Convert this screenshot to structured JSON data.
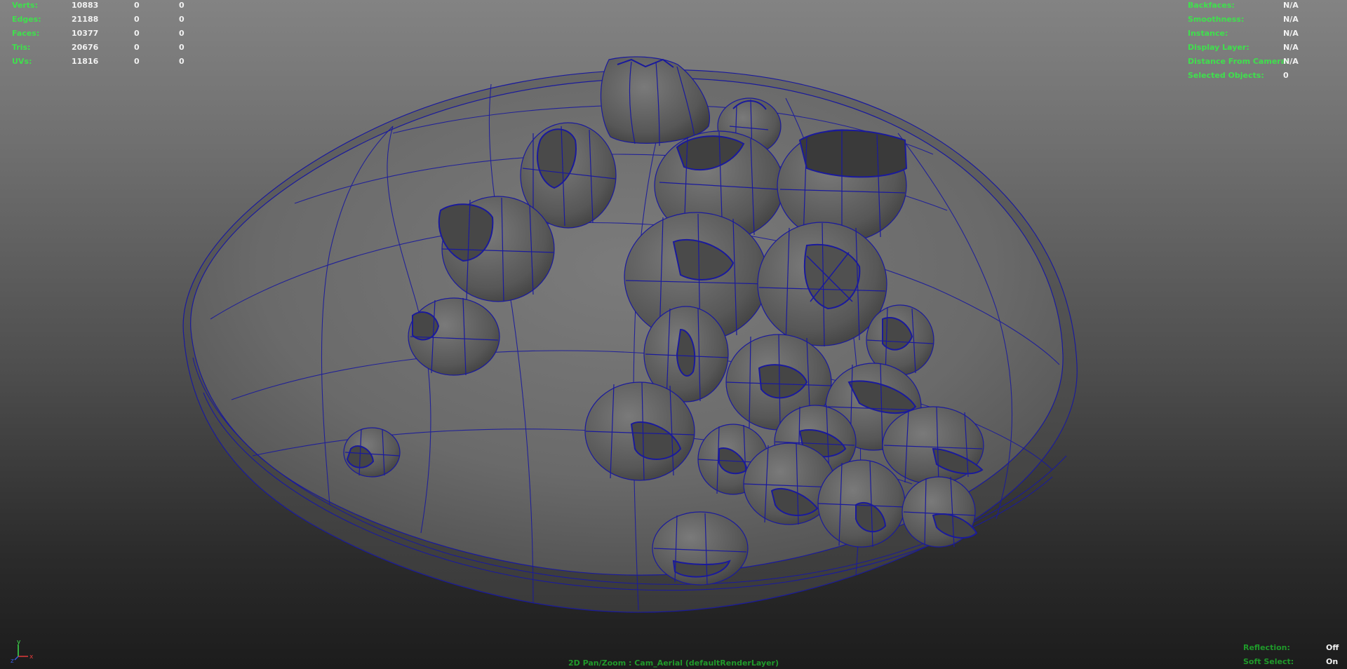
{
  "hud": {
    "stats": [
      {
        "label": "Verts:",
        "values": [
          "10883",
          "0",
          "0"
        ]
      },
      {
        "label": "Edges:",
        "values": [
          "21188",
          "0",
          "0"
        ]
      },
      {
        "label": "Faces:",
        "values": [
          "10377",
          "0",
          "0"
        ]
      },
      {
        "label": "Tris:",
        "values": [
          "20676",
          "0",
          "0"
        ]
      },
      {
        "label": "UVs:",
        "values": [
          "11816",
          "0",
          "0"
        ]
      }
    ],
    "object_info": [
      {
        "label": "Backfaces:",
        "value": "N/A"
      },
      {
        "label": "Smoothness:",
        "value": "N/A"
      },
      {
        "label": "Instance:",
        "value": "N/A"
      },
      {
        "label": "Display Layer:",
        "value": "N/A"
      },
      {
        "label": "Distance From Camera:",
        "value": "N/A"
      },
      {
        "label": "Selected Objects:",
        "value": "0"
      }
    ],
    "toggles": [
      {
        "label": "Reflection:",
        "value": "Off"
      },
      {
        "label": "Soft Select:",
        "value": "On"
      }
    ],
    "camera_label": "2D Pan/Zoom : Cam_Aerial (defaultRenderLayer)",
    "axis": {
      "x": "x",
      "y": "y",
      "z": "z"
    }
  },
  "colors": {
    "hud_label": "#3fe04d",
    "hud_value": "#f2f2f2",
    "wireframe": "#1a1a9c",
    "shell": "#6e6e6e",
    "barnacle": "#5f5f5f"
  }
}
